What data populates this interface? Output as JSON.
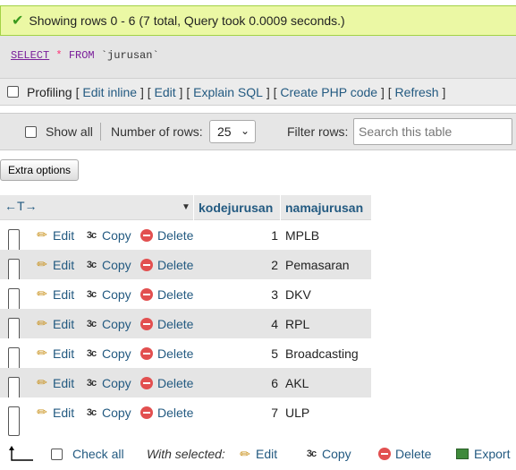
{
  "status": {
    "message": "Showing rows 0 - 6 (7 total, Query took 0.0009 seconds.)"
  },
  "sql": {
    "select": "SELECT",
    "star": "*",
    "from": "FROM",
    "table": "`jurusan`"
  },
  "tools": {
    "profiling": "Profiling",
    "edit_inline": "Edit inline",
    "edit": "Edit",
    "explain": "Explain SQL",
    "create_php": "Create PHP code",
    "refresh": "Refresh"
  },
  "nav": {
    "show_all": "Show all",
    "number_of_rows_label": "Number of rows:",
    "rows_value": "25",
    "filter_label": "Filter rows:",
    "search_placeholder": "Search this table"
  },
  "extra_options": "Extra options",
  "columns": [
    "kodejurusan",
    "namajurusan"
  ],
  "row_actions": {
    "edit": "Edit",
    "copy": "Copy",
    "delete": "Delete"
  },
  "rows": [
    {
      "kode": "1",
      "nama": "MPLB"
    },
    {
      "kode": "2",
      "nama": "Pemasaran"
    },
    {
      "kode": "3",
      "nama": "DKV"
    },
    {
      "kode": "4",
      "nama": "RPL"
    },
    {
      "kode": "5",
      "nama": "Broadcasting"
    },
    {
      "kode": "6",
      "nama": "AKL"
    },
    {
      "kode": "7",
      "nama": "ULP"
    }
  ],
  "footer": {
    "check_all": "Check all",
    "with_selected": "With selected:",
    "edit": "Edit",
    "copy": "Copy",
    "delete": "Delete",
    "export": "Export"
  },
  "colors": {
    "link": "#235a81",
    "success_bg": "#ebf8a4",
    "delete": "#e25050"
  }
}
